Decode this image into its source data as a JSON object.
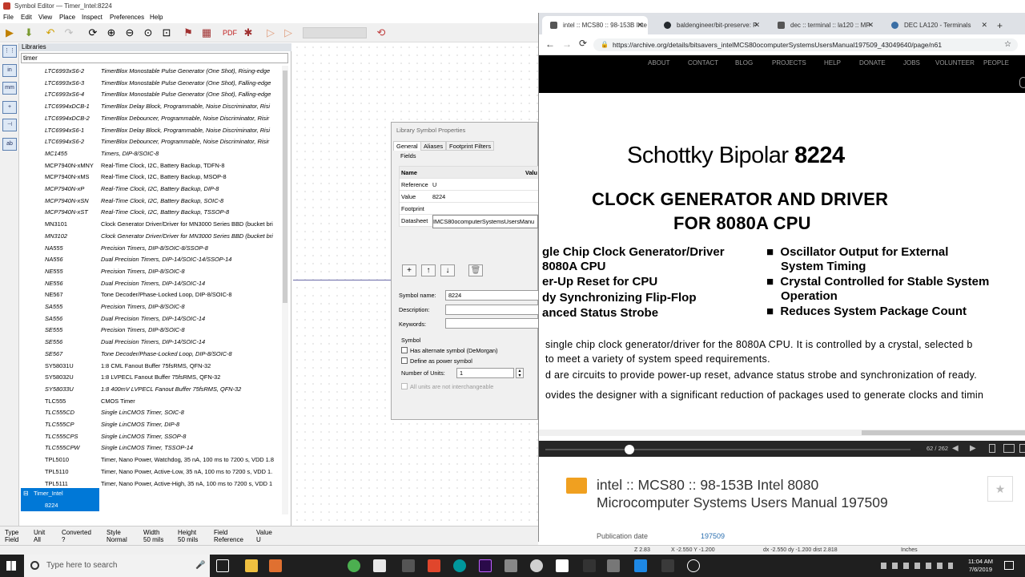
{
  "kicad": {
    "title": "Symbol Editor — Timer_Intel:8224",
    "menu": [
      "File",
      "Edit",
      "View",
      "Place",
      "Inspect",
      "Preferences",
      "Help"
    ],
    "left_tools": [
      "in",
      "mm",
      "",
      "",
      ""
    ],
    "libraries_header": "Libraries",
    "search_value": "timer",
    "rows": [
      {
        "name": "LTC6993xS6-2",
        "desc": "TimerBlox Monostable Pulse Generator (One Shot), Rising-edge",
        "italic": true
      },
      {
        "name": "LTC6993xS6-3",
        "desc": "TimerBlox Monostable Pulse Generator (One Shot), Falling-edge",
        "italic": true
      },
      {
        "name": "LTC6993xS6-4",
        "desc": "TimerBlox Monostable Pulse Generator (One Shot), Falling-edge",
        "italic": true
      },
      {
        "name": "LTC6994xDCB-1",
        "desc": "TimerBlox Delay Block, Programmable, Noise Discriminator, Risi",
        "italic": true
      },
      {
        "name": "LTC6994xDCB-2",
        "desc": "TimerBlox Debouncer, Programmable, Noise Discriminator, Risir",
        "italic": true
      },
      {
        "name": "LTC6994xS6-1",
        "desc": "TimerBlox Delay Block, Programmable, Noise Discriminator, Risi",
        "italic": true
      },
      {
        "name": "LTC6994xS6-2",
        "desc": "TimerBlox Debouncer, Programmable, Noise Discriminator, Risir",
        "italic": true
      },
      {
        "name": "MC1455",
        "desc": "Timers, DIP-8/SOIC-8",
        "italic": true
      },
      {
        "name": "MCP7940N-xMNY",
        "desc": "Real-Time Clock, I2C, Battery Backup, TDFN-8",
        "italic": false
      },
      {
        "name": "MCP7940N-xMS",
        "desc": "Real-Time Clock, I2C, Battery Backup, MSOP-8",
        "italic": false
      },
      {
        "name": "MCP7940N-xP",
        "desc": "Real-Time Clock, I2C, Battery Backup, DIP-8",
        "italic": true
      },
      {
        "name": "MCP7940N-xSN",
        "desc": "Real-Time Clock, I2C, Battery Backup, SOIC-8",
        "italic": true
      },
      {
        "name": "MCP7940N-xST",
        "desc": "Real-Time Clock, I2C, Battery Backup, TSSOP-8",
        "italic": true
      },
      {
        "name": "MN3101",
        "desc": "Clock Generator Driver/Driver for MN3000 Series BBD (bucket bri",
        "italic": false
      },
      {
        "name": "MN3102",
        "desc": "Clock Generator Driver/Driver for MN3000 Series BBD (bucket bri",
        "italic": true
      },
      {
        "name": "NA555",
        "desc": "Precision Timers, DIP-8/SOIC-8/SSOP-8",
        "italic": true
      },
      {
        "name": "NA556",
        "desc": "Dual Precision Timers, DIP-14/SOIC-14/SSOP-14",
        "italic": true
      },
      {
        "name": "NE555",
        "desc": "Precision Timers, DIP-8/SOIC-8",
        "italic": true
      },
      {
        "name": "NE556",
        "desc": "Dual Precision Timers, DIP-14/SOIC-14",
        "italic": true
      },
      {
        "name": "NE567",
        "desc": "Tone Decoder/Phase-Locked Loop, DIP-8/SOIC-8",
        "italic": false
      },
      {
        "name": "SA555",
        "desc": "Precision Timers, DIP-8/SOIC-8",
        "italic": true
      },
      {
        "name": "SA556",
        "desc": "Dual Precision Timers, DIP-14/SOIC-14",
        "italic": true
      },
      {
        "name": "SE555",
        "desc": "Precision Timers, DIP-8/SOIC-8",
        "italic": true
      },
      {
        "name": "SE556",
        "desc": "Dual Precision Timers, DIP-14/SOIC-14",
        "italic": true
      },
      {
        "name": "SE567",
        "desc": "Tone Decoder/Phase-Locked Loop, DIP-8/SOIC-8",
        "italic": true
      },
      {
        "name": "SY58031U",
        "desc": "1:8 CML Fanout Buffer 75fsRMS, QFN-32",
        "italic": false
      },
      {
        "name": "SY58032U",
        "desc": "1:8 LVPECL Fanout Buffer 75fsRMS, QFN-32",
        "italic": false
      },
      {
        "name": "SY58033U",
        "desc": "1:8 400mV LVPECL Fanout Buffer 75fsRMS, QFN-32",
        "italic": true
      },
      {
        "name": "TLC555",
        "desc": "CMOS Timer",
        "italic": false
      },
      {
        "name": "TLC555CD",
        "desc": "Single LinCMOS Timer, SOIC-8",
        "italic": true
      },
      {
        "name": "TLC555CP",
        "desc": "Single LinCMOS Timer, DIP-8",
        "italic": true
      },
      {
        "name": "TLC555CPS",
        "desc": "Single LinCMOS Timer, SSOP-8",
        "italic": true
      },
      {
        "name": "TLC555CPW",
        "desc": "Single LinCMOS Timer, TSSOP-14",
        "italic": true
      },
      {
        "name": "TPL5010",
        "desc": "Timer, Nano Power, Watchdog, 35 nA, 100 ms to 7200 s, VDD 1.8",
        "italic": false
      },
      {
        "name": "TPL5110",
        "desc": "Timer, Nano Power, Active-Low, 35 nA, 100 ms to 7200 s, VDD 1.",
        "italic": false
      },
      {
        "name": "TPL5111",
        "desc": "Timer, Nano Power, Active-High, 35 nA, 100 ms to 7200 s, VDD 1",
        "italic": false
      }
    ],
    "selected_lib": "Timer_Intel",
    "selected_item": "8224",
    "props": [
      {
        "h": "Type",
        "v": "Field"
      },
      {
        "h": "Unit",
        "v": "All"
      },
      {
        "h": "Converted",
        "v": "?"
      },
      {
        "h": "Style",
        "v": "Normal"
      },
      {
        "h": "Width",
        "v": "50 mils"
      },
      {
        "h": "Height",
        "v": "50 mils"
      },
      {
        "h": "Field",
        "v": "Reference"
      },
      {
        "h": "Value",
        "v": "U"
      }
    ]
  },
  "dialog": {
    "title": "Library Symbol Properties",
    "tabs": [
      "General",
      "Aliases",
      "Footprint Filters"
    ],
    "fields_label": "Fields",
    "col_name": "Name",
    "col_value": "Valu",
    "fields": [
      {
        "k": "Reference",
        "v": "U"
      },
      {
        "k": "Value",
        "v": "8224"
      },
      {
        "k": "Footprint",
        "v": ""
      },
      {
        "k": "Datasheet",
        "v": "IMCS80ocomputerSystemsUsersManu"
      }
    ],
    "symbol_name_label": "Symbol name:",
    "symbol_name": "8224",
    "description_label": "Description:",
    "keywords_label": "Keywords:",
    "symbol_group": "Symbol",
    "alt_symbol": "Has alternate symbol (DeMorgan)",
    "power_symbol": "Define as power symbol",
    "units_label": "Number of Units:",
    "units": "1",
    "interchange": "All units are not interchangeable"
  },
  "chrome": {
    "tabs": [
      {
        "title": "intel :: MCS80 :: 98-153B Inte",
        "color": "#555"
      },
      {
        "title": "baldengineer/bit-preserve: P",
        "color": "#24292e"
      },
      {
        "title": "dec :: terminal :: la120 :: MP",
        "color": "#555"
      },
      {
        "title": "DEC LA120 - Terminals",
        "color": "#3a6ea5"
      }
    ],
    "url": "https://archive.org/details/bitsavers_intelMCS80ocomputerSystemsUsersManual197509_43049640/page/n61",
    "nav": [
      "ABOUT",
      "CONTACT",
      "BLOG",
      "PROJECTS",
      "HELP",
      "DONATE",
      "JOBS",
      "VOLUNTEER",
      "PEOPLE"
    ],
    "doc_title_a": "Schottky Bipolar ",
    "doc_title_b": "8224",
    "h1a": "CLOCK GENERATOR AND DRIVER",
    "h1b": "FOR 8080A CPU",
    "feat_left": [
      "gle Chip Clock Generator/Driver",
      "8080A CPU",
      "er-Up Reset for CPU",
      "dy Synchronizing Flip-Flop",
      "anced Status Strobe"
    ],
    "feat_right": [
      "Oscillator Output for External",
      "System Timing",
      "Crystal Controlled for Stable System",
      "Operation",
      "Reduces System Package Count"
    ],
    "body": [
      "single chip clock generator/driver for the 8080A CPU. It is controlled by a crystal, selected b",
      "to meet a variety of system speed requirements.",
      "d are circuits to provide power-up reset, advance status strobe and synchronization of ready.",
      "ovides the designer with a significant reduction of packages used to generate clocks and timin"
    ],
    "page_indicator": "62 / 262",
    "progress": 0.23,
    "book_title": "intel :: MCS80 :: 98-153B Intel 8080 Microcomputer Systems Users Manual 197509",
    "pub_label": "Publication date",
    "pub_value": "197509"
  },
  "status": {
    "zoom": "Z 2.83",
    "xy": "X -2.550  Y -1.200",
    "dxdy": "dx -2.550  dy -1.200  dist 2.818",
    "units": "Inches"
  },
  "taskbar": {
    "search": "Type here to search",
    "time": "11:04 AM",
    "date": "7/6/2019"
  }
}
